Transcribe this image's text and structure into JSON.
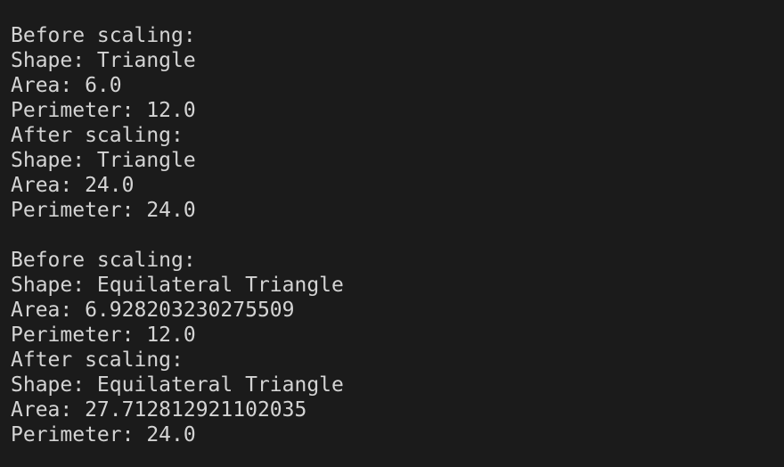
{
  "terminal": {
    "output": {
      "block1": {
        "before_label": "Before scaling:",
        "before_shape": "Shape: Triangle",
        "before_area": "Area: 6.0",
        "before_perimeter": "Perimeter: 12.0",
        "after_label": "After scaling:",
        "after_shape": "Shape: Triangle",
        "after_area": "Area: 24.0",
        "after_perimeter": "Perimeter: 24.0"
      },
      "block2": {
        "before_label": "Before scaling:",
        "before_shape": "Shape: Equilateral Triangle",
        "before_area": "Area: 6.928203230275509",
        "before_perimeter": "Perimeter: 12.0",
        "after_label": "After scaling:",
        "after_shape": "Shape: Equilateral Triangle",
        "after_area": "Area: 27.712812921102035",
        "after_perimeter": "Perimeter: 24.0"
      }
    },
    "colors": {
      "background": "#1b1b1b",
      "text": "#d4d4d4"
    }
  }
}
